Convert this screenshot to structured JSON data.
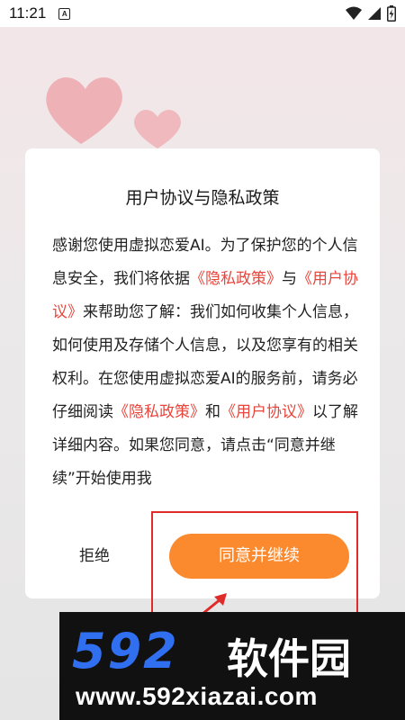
{
  "statusbar": {
    "time": "11:21",
    "notification_icon": "a-icon",
    "wifi_icon": "wifi-icon",
    "signal_icon": "signal-icon",
    "battery_icon": "battery-charging-icon"
  },
  "background": {
    "decoration": "hearts-icon"
  },
  "dialog": {
    "title": "用户协议与隐私政策",
    "body": [
      {
        "text": "感谢您使用虚拟恋爱AI。为了保护您的个人信息安全，我们将依据",
        "link": false
      },
      {
        "text": "《隐私政策》",
        "link": true
      },
      {
        "text": "与",
        "link": false
      },
      {
        "text": "《用户协议》",
        "link": true
      },
      {
        "text": "来帮助您了解：我们如何收集个人信息，如何使用及存储个人信息，以及您享有的相关权利。在您使用虚拟恋爱AI的服务前，请务必仔细阅读",
        "link": false
      },
      {
        "text": "《隐私政策》",
        "link": true
      },
      {
        "text": "和",
        "link": false
      },
      {
        "text": "《用户协议》",
        "link": true
      },
      {
        "text": "以了解详细内容。如果您同意，请点击“同意并继续”开始使用我",
        "link": false
      }
    ],
    "reject_label": "拒绝",
    "agree_label": "同意并继续",
    "link_color": "#e8453c",
    "agree_color": "#fb8a2e"
  },
  "watermark": {
    "brand_number": "592",
    "brand_name": "软件园",
    "url": "www.592xiazai.com"
  }
}
